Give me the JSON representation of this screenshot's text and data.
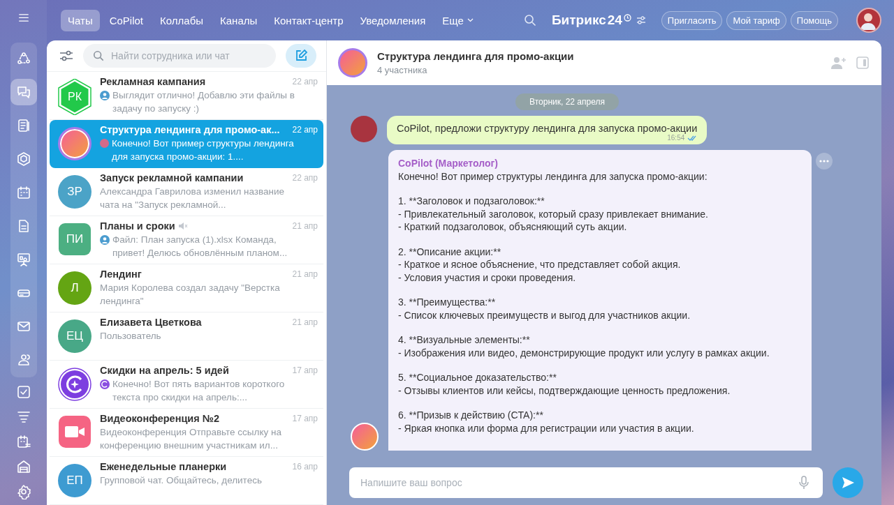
{
  "topbar": {
    "tabs": [
      {
        "label": "Чаты",
        "selected": true
      },
      {
        "label": "CoPilot",
        "selected": false
      },
      {
        "label": "Коллабы",
        "selected": false
      },
      {
        "label": "Каналы",
        "selected": false
      },
      {
        "label": "Контакт-центр",
        "selected": false
      },
      {
        "label": "Уведомления",
        "selected": false
      }
    ],
    "more": "Еще",
    "logo": "Битрикс",
    "logo_number": "24",
    "buttons": [
      "Пригласить",
      "Мой тариф",
      "Помощь"
    ]
  },
  "rail": {
    "items": [
      {
        "selected": false
      },
      {
        "selected": true
      },
      {
        "selected": false
      },
      {
        "selected": false
      },
      {
        "selected": false
      },
      {
        "selected": false
      },
      {
        "selected": false
      },
      {
        "selected": false
      },
      {
        "selected": false
      },
      {
        "selected": false
      },
      {
        "selected": false
      },
      {
        "selected": false
      },
      {
        "selected": false
      },
      {
        "selected": false
      },
      {
        "selected": false
      }
    ]
  },
  "chat_list": {
    "search": {
      "placeholder": "Найти сотрудника или чат"
    },
    "items": [
      {
        "title": "Рекламная кампания",
        "date": "22 апр",
        "preview": "Выглядит отлично! Добавлю эти файлы в задачу по запуску :)",
        "sender": {
          "kind": "user"
        },
        "avatar": {
          "kind": "hexagon",
          "initials": "РК",
          "color": "#22c94a"
        },
        "selected": false,
        "muted": false
      },
      {
        "title": "Структура лендинга для промо-ак...",
        "date": "22 апр",
        "preview": "Конечно! Вот пример структуры лендинга для запуска промо-акции: 1....",
        "sender": {
          "kind": "photo"
        },
        "avatar": {
          "kind": "photo",
          "color": "#a77be8"
        },
        "selected": true,
        "muted": false
      },
      {
        "title": "Запуск рекламной кампании",
        "date": "22 апр",
        "preview": "Александра Гаврилова изменил название чата на \"Запуск рекламной...",
        "avatar": {
          "kind": "circle",
          "initials": "ЗР",
          "color": "#4ba3c7"
        },
        "selected": false,
        "muted": false
      },
      {
        "title": "Планы и сроки",
        "date": "21 апр",
        "preview": "Файл: План запуска (1).xlsx Команда, привет! Делюсь обновлённым планом...",
        "sender": {
          "kind": "user"
        },
        "avatar": {
          "kind": "square",
          "initials": "ПИ",
          "color": "#4caf82"
        },
        "selected": false,
        "muted": true
      },
      {
        "title": "Лендинг",
        "date": "21 апр",
        "preview": "Мария Королева создал задачу \"Верстка лендинга\"",
        "avatar": {
          "kind": "circle",
          "initials": "Л",
          "color": "#64a513"
        },
        "selected": false,
        "muted": false
      },
      {
        "title": "Елизавета Цветкова",
        "date": "21 апр",
        "preview": "Пользователь",
        "avatar": {
          "kind": "circle",
          "initials": "ЕЦ",
          "color": "#48a887"
        },
        "selected": false,
        "muted": false
      },
      {
        "title": "Скидки на апрель: 5 идей",
        "date": "17 апр",
        "preview": "Конечно! Вот пять вариантов короткого текста про скидки на апрель:...",
        "sender": {
          "kind": "copilot"
        },
        "avatar": {
          "kind": "copilot",
          "color": "#7d3ee0"
        },
        "selected": false,
        "muted": false
      },
      {
        "title": "Видеоконференция №2",
        "date": "17 апр",
        "preview": "Видеоконференция Отправьте ссылку на конференцию внешним участникам ил...",
        "avatar": {
          "kind": "video",
          "color": "#f56483"
        },
        "selected": false,
        "muted": false
      },
      {
        "title": "Еженедельные планерки",
        "date": "16 апр",
        "preview": "Групповой чат. Общайтесь, делитесь",
        "avatar": {
          "kind": "circle",
          "initials": "ЕП",
          "color": "#3e9bd1"
        },
        "selected": false,
        "muted": false
      }
    ]
  },
  "chat": {
    "title": "Структура лендинга для промо-акции",
    "subtitle": "4 участника",
    "date_divider": "Вторник, 22 апреля",
    "user_message": {
      "text": "CoPilot, предложи структуру лендинга для запуска промо-акции",
      "time": "16:54"
    },
    "bot_message": {
      "author": "CoPilot (Маркетолог)",
      "blocks": [
        [
          "Конечно! Вот пример структуры лендинга для запуска промо-акции:"
        ],
        [
          "1. **Заголовок и подзаголовок:**",
          "- Привлекательный заголовок, который сразу привлекает внимание.",
          "- Краткий подзаголовок, объясняющий суть акции."
        ],
        [
          "2. **Описание акции:**",
          "- Краткое и ясное объяснение, что представляет собой акция.",
          "- Условия участия и сроки проведения."
        ],
        [
          "3. **Преимущества:**",
          "- Список ключевых преимуществ и выгод для участников акции."
        ],
        [
          "4. **Визуальные элементы:**",
          "- Изображения или видео, демонстрирующие продукт или услугу в рамках акции."
        ],
        [
          "5. **Социальное доказательство:**",
          "- Отзывы клиентов или кейсы, подтверждающие ценность предложения."
        ],
        [
          "6. **Призыв к действию (CTA):**",
          "- Яркая кнопка или форма для регистрации или участия в акции."
        ]
      ]
    },
    "composer": {
      "placeholder": "Напишите ваш вопрос"
    }
  }
}
